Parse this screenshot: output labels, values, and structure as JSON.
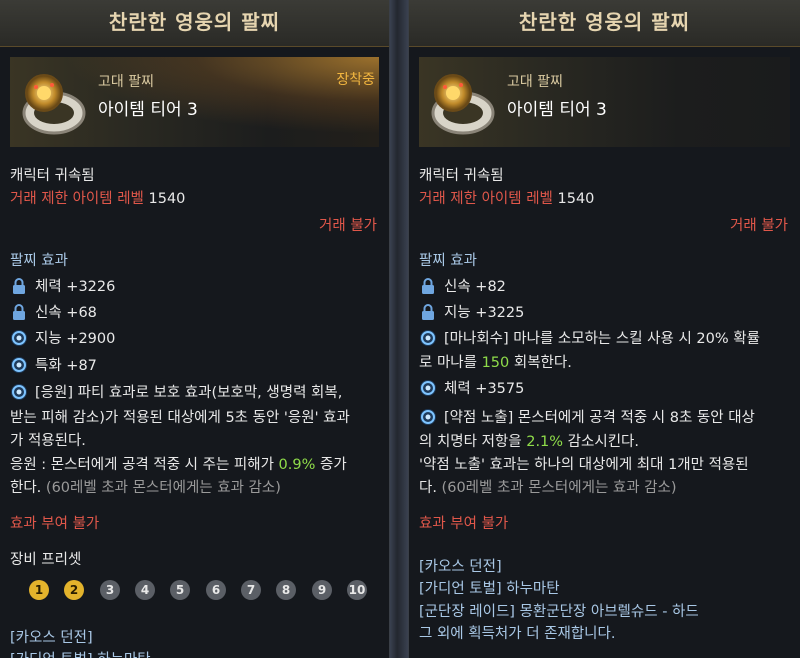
{
  "left": {
    "title": "찬란한 영웅의 팔찌",
    "grade": "고대 팔찌",
    "tier": "아이템 티어 3",
    "equipped": "장착중",
    "bound": "캐릭터 귀속됨",
    "trade_level_label": "거래 제한 아이템 레벨",
    "trade_level_value": "1540",
    "trade_status": "거래 불가",
    "effect_header": "팔찌 효과",
    "stats": [
      {
        "icon": "lock-icon",
        "text": "체력 +3226"
      },
      {
        "icon": "lock-icon",
        "text": "신속 +68"
      },
      {
        "icon": "swirl-icon",
        "text": "지능 +2900"
      },
      {
        "icon": "swirl-icon",
        "text": "특화 +87"
      }
    ],
    "special_line1": "[응원] 파티 효과로 보호 효과(보호막, 생명력 회복,",
    "special_line2": "받는 피해 감소)가 적용된 대상에게 5초 동안 '응원' 효과",
    "special_line3": "가 적용된다.",
    "cheer_line1_a": "응원 : 몬스터에게 공격 적중 시 주는 피해가 ",
    "cheer_line1_pct": "0.9%",
    "cheer_line1_b": " 증가",
    "cheer_line2_a": "한다.",
    "cheer_line2_b": " (60레벨 초과 몬스터에게는 효과 감소)",
    "grant_disabled": "효과 부여 불가",
    "preset_header": "장비 프리셋",
    "presets": [
      {
        "label": "1",
        "active": true
      },
      {
        "label": "2",
        "active": true
      },
      {
        "label": "3",
        "active": false
      },
      {
        "label": "4",
        "active": false
      },
      {
        "label": "5",
        "active": false
      },
      {
        "label": "6",
        "active": false
      },
      {
        "label": "7",
        "active": false
      },
      {
        "label": "8",
        "active": false
      },
      {
        "label": "9",
        "active": false
      },
      {
        "label": "10",
        "active": false
      }
    ],
    "source1": "[카오스 던전]",
    "source2": "[가디언 토벌] 하누마탄"
  },
  "right": {
    "title": "찬란한 영웅의 팔찌",
    "grade": "고대 팔찌",
    "tier": "아이템 티어 3",
    "bound": "캐릭터 귀속됨",
    "trade_level_label": "거래 제한 아이템 레벨",
    "trade_level_value": "1540",
    "trade_status": "거래 불가",
    "effect_header": "팔찌 효과",
    "stat1": "신속 +82",
    "stat2": "지능 +3225",
    "mana_line1": "[마나회수] 마나를 소모하는 스킬 사용 시 20% 확률",
    "mana_line2_a": "로 마나를 ",
    "mana_line2_val": "150",
    "mana_line2_b": " 회복한다.",
    "stat3": "체력 +3575",
    "weak_line1": "[약점 노출] 몬스터에게 공격 적중 시 8초 동안 대상",
    "weak_line2_a": "의 치명타 저항을 ",
    "weak_line2_val": "2.1%",
    "weak_line2_b": " 감소시킨다.",
    "weak_line3": "'약점 노출' 효과는 하나의 대상에게 최대 1개만 적용된",
    "weak_line4_a": "다.",
    "weak_line4_b": " (60레벨 초과 몬스터에게는 효과 감소)",
    "grant_disabled": "효과 부여 불가",
    "source1": "[카오스 던전]",
    "source2": "[가디언 토벌] 하누마탄",
    "source3": "[군단장 레이드] 몽환군단장 아브렐슈드 - 하드",
    "source4": "그 외에 획득처가 더 존재합니다."
  }
}
